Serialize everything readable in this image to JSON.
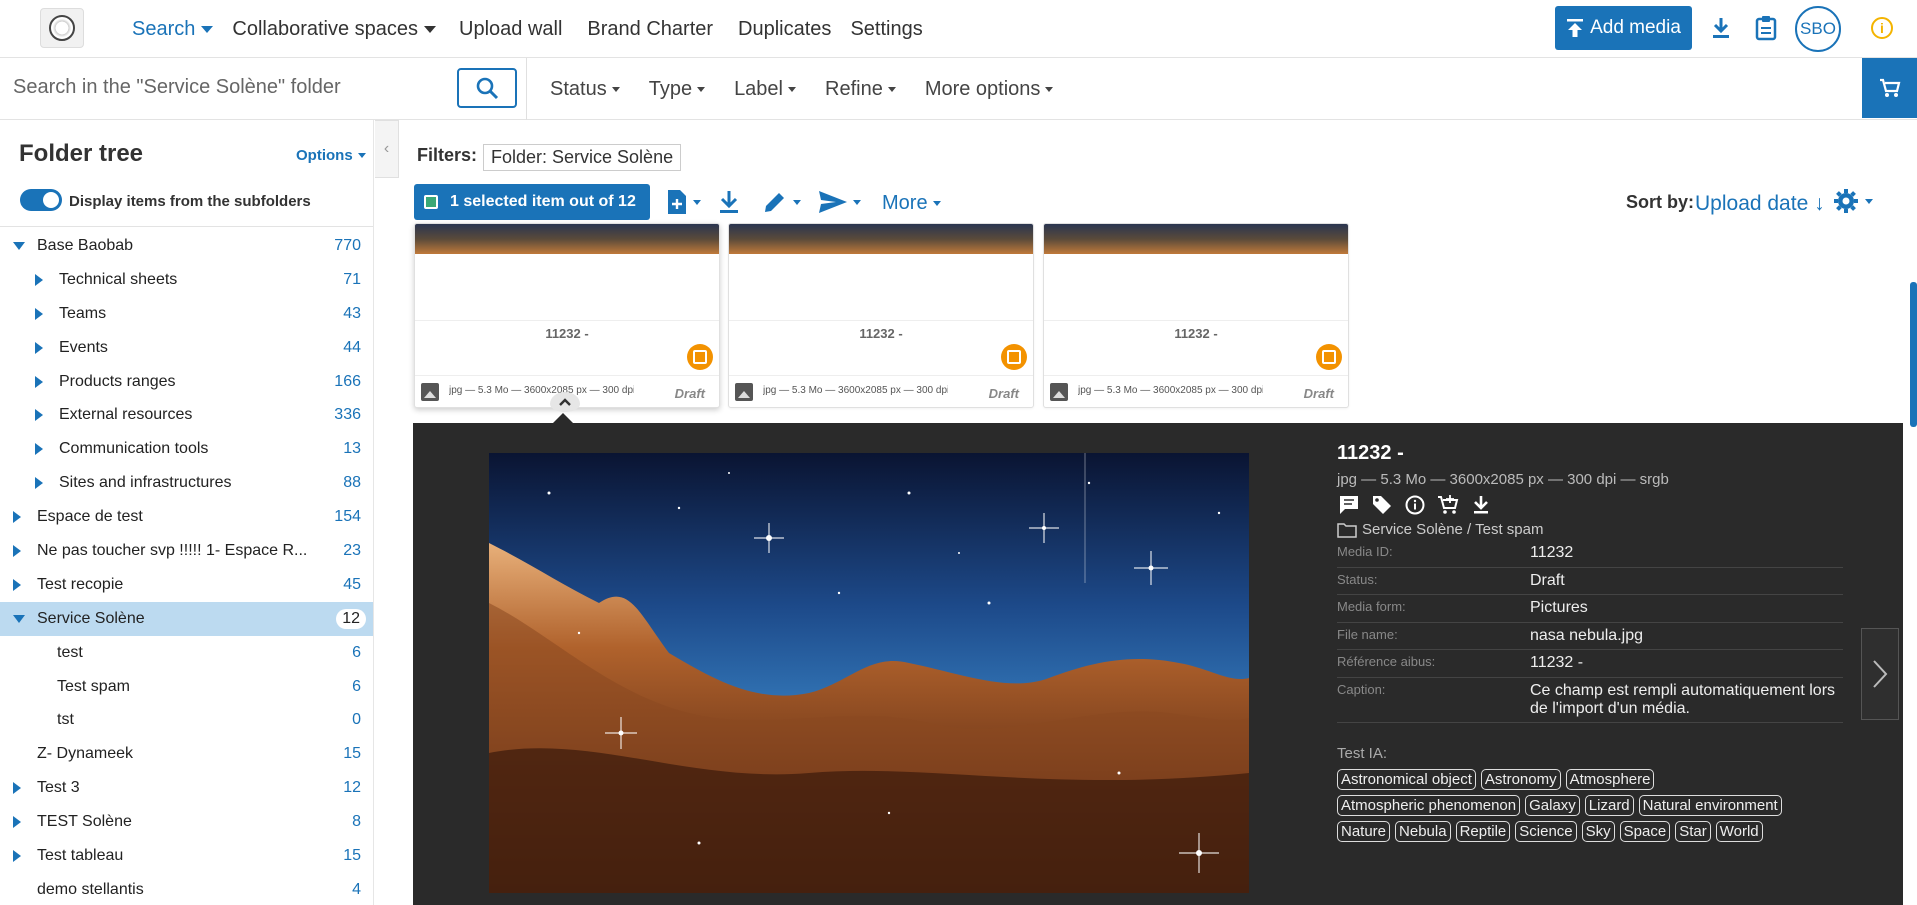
{
  "nav": {
    "search": "Search",
    "collaborative": "Collaborative spaces",
    "upload_wall": "Upload wall",
    "brand_charter": "Brand Charter",
    "duplicates": "Duplicates",
    "settings": "Settings",
    "add_media": "Add media",
    "avatar": "SBO",
    "info": "i"
  },
  "toolbar": {
    "search_placeholder": "Search in the \"Service Solène\" folder",
    "filters": [
      "Status",
      "Type",
      "Label",
      "Refine",
      "More options"
    ]
  },
  "sidebar": {
    "title": "Folder tree",
    "options": "Options",
    "toggle_label": "Display items from the subfolders",
    "items": [
      {
        "label": "Base Baobab",
        "count": "770"
      },
      {
        "label": "Technical sheets",
        "count": "71"
      },
      {
        "label": "Teams",
        "count": "43"
      },
      {
        "label": "Events",
        "count": "44"
      },
      {
        "label": "Products ranges",
        "count": "166"
      },
      {
        "label": "External resources",
        "count": "336"
      },
      {
        "label": "Communication tools",
        "count": "13"
      },
      {
        "label": "Sites and infrastructures",
        "count": "88"
      },
      {
        "label": "Espace de test",
        "count": "154"
      },
      {
        "label": "Ne pas toucher svp !!!!! 1- Espace R...",
        "count": "23"
      },
      {
        "label": "Test recopie",
        "count": "45"
      },
      {
        "label": "Service Solène",
        "count": "12"
      },
      {
        "label": "test",
        "count": "6"
      },
      {
        "label": "Test spam",
        "count": "6"
      },
      {
        "label": "tst",
        "count": "0"
      },
      {
        "label": "Z- Dynameek",
        "count": "15"
      },
      {
        "label": "Test 3",
        "count": "12"
      },
      {
        "label": "TEST Solène",
        "count": "8"
      },
      {
        "label": "Test tableau",
        "count": "15"
      },
      {
        "label": "demo stellantis",
        "count": "4"
      }
    ]
  },
  "main": {
    "filters_label": "Filters:",
    "filter_chip": "Folder: Service Solène",
    "selected": "1 selected item out of 12",
    "more": "More",
    "sort_label": "Sort by:",
    "sort_value": "Upload date ↓"
  },
  "cards": [
    {
      "title": "11232 -",
      "meta": "jpg — 5.3 Mo — 3600x2085 px — 300 dpi",
      "status": "Draft"
    },
    {
      "title": "11232 -",
      "meta": "jpg — 5.3 Mo — 3600x2085 px — 300 dpi",
      "status": "Draft"
    },
    {
      "title": "11232 -",
      "meta": "jpg — 5.3 Mo — 3600x2085 px — 300 dpi",
      "status": "Draft"
    }
  ],
  "preview": {
    "title": "11232 -",
    "meta": "jpg — 5.3 Mo — 3600x2085 px — 300 dpi — srgb",
    "path": "Service Solène / Test spam",
    "rows": [
      {
        "key": "Media ID:",
        "value": "11232"
      },
      {
        "key": "Status:",
        "value": "Draft"
      },
      {
        "key": "Media form:",
        "value": "Pictures"
      },
      {
        "key": "File name:",
        "value": "nasa nebula.jpg"
      },
      {
        "key": "Référence aibus:",
        "value": "11232 -"
      },
      {
        "key": "Caption:",
        "value": "Ce champ est rempli automatiquement lors de l'import d'un média."
      }
    ],
    "tags_label": "Test IA:",
    "tags": [
      "Astronomical object",
      "Astronomy",
      "Atmosphere",
      "Atmospheric phenomenon",
      "Galaxy",
      "Lizard",
      "Natural environment",
      "Nature",
      "Nebula",
      "Reptile",
      "Science",
      "Sky",
      "Space",
      "Star",
      "World"
    ]
  },
  "colors": {
    "accent": "#1a73b8",
    "badge": "#f39200",
    "preview_bg": "#2a2a2a",
    "selected_row": "#bcdaf0"
  }
}
